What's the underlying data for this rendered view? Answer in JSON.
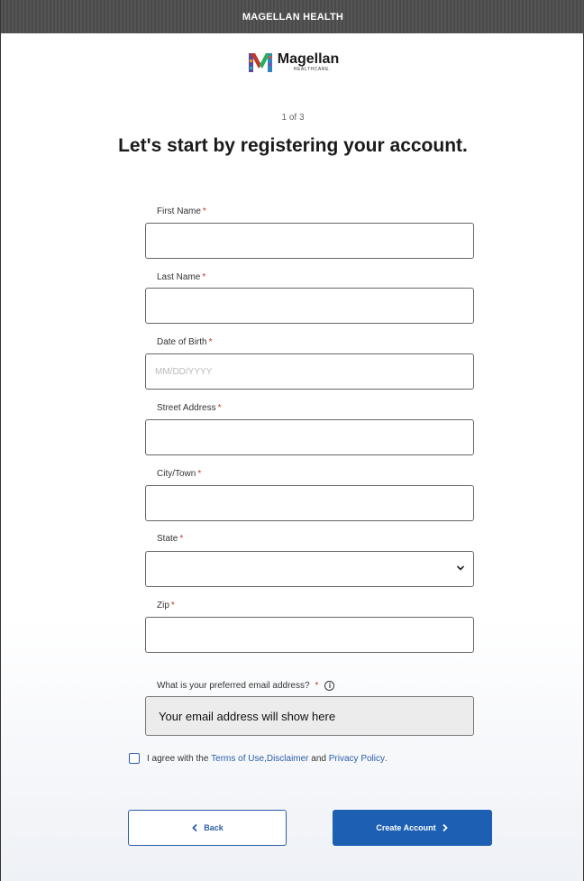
{
  "header": {
    "title": "MAGELLAN HEALTH"
  },
  "logo": {
    "name": "Magellan",
    "sub": "HEALTHCARE."
  },
  "step": "1 of 3",
  "title": "Let's start by registering your account.",
  "fields": {
    "first_name": {
      "label": "First Name",
      "value": ""
    },
    "last_name": {
      "label": "Last Name",
      "value": ""
    },
    "dob": {
      "label": "Date of Birth",
      "placeholder": "MM/DD/YYYY",
      "value": ""
    },
    "street": {
      "label": "Street Address",
      "value": ""
    },
    "city": {
      "label": "City/Town",
      "value": ""
    },
    "state": {
      "label": "State",
      "value": ""
    },
    "zip": {
      "label": "Zip",
      "value": ""
    }
  },
  "required_mark": "*",
  "email": {
    "label": "What is your preferred email address?",
    "info_icon": "i",
    "value": "Your email address will show here"
  },
  "agreement": {
    "prefix": "I agree with the ",
    "terms": "Terms of Use",
    "sep": ", ",
    "disclaimer": "Disclaimer",
    "and": " and ",
    "privacy": "Privacy Policy",
    "suffix": "."
  },
  "buttons": {
    "back": "Back",
    "create": "Create Account"
  },
  "colors": {
    "primary": "#1d5fb3",
    "link": "#2a5ea8",
    "required": "#c0392b"
  }
}
